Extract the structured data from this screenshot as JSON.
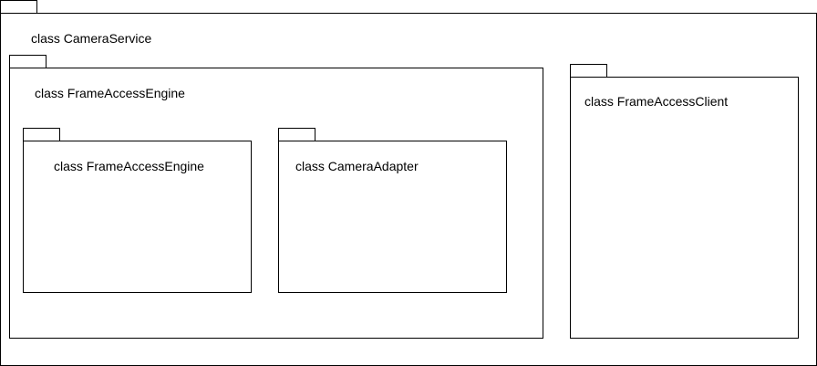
{
  "diagram": {
    "packages": {
      "camera_service": {
        "label": "class CameraService"
      },
      "frame_access_engine_outer": {
        "label": "class FrameAccessEngine"
      },
      "frame_access_engine_inner": {
        "label": "class FrameAccessEngine"
      },
      "camera_adapter": {
        "label": "class CameraAdapter"
      },
      "frame_access_client": {
        "label": "class FrameAccessClient"
      }
    },
    "colors": {
      "stroke": "#000000",
      "fill": "#ffffff"
    }
  }
}
